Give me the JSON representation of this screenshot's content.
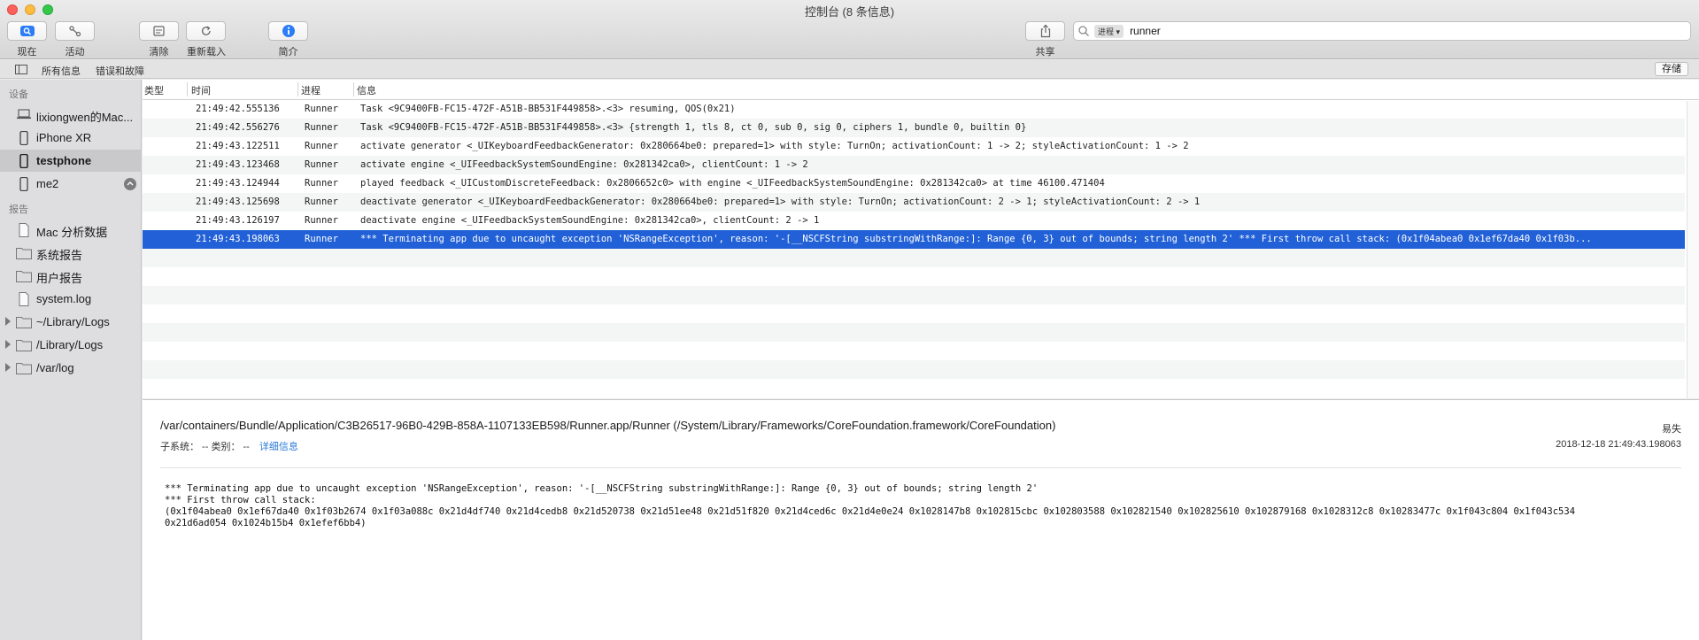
{
  "window": {
    "title": "控制台 (8 条信息)"
  },
  "toolbar": {
    "now_label": "现在",
    "activity_label": "活动",
    "clear_label": "清除",
    "reload_label": "重新载入",
    "info_label": "简介",
    "share_label": "共享",
    "search_filter_chip": "进程",
    "search_query": "runner"
  },
  "filterbar": {
    "all_messages": "所有信息",
    "errors_faults": "错误和故障",
    "save_label": "存储"
  },
  "sidebar": {
    "devices_header": "设备",
    "devices": [
      {
        "label": "lixiongwen的Mac...",
        "icon": "laptop-icon"
      },
      {
        "label": "iPhone XR",
        "icon": "phone-icon"
      },
      {
        "label": "testphone",
        "icon": "phone-icon"
      },
      {
        "label": "me2",
        "icon": "phone-icon"
      }
    ],
    "reports_header": "报告",
    "reports": [
      {
        "label": "Mac 分析数据",
        "icon": "document-icon"
      },
      {
        "label": "系统报告",
        "icon": "folder-icon"
      },
      {
        "label": "用户报告",
        "icon": "folder-icon"
      },
      {
        "label": "system.log",
        "icon": "document-icon"
      },
      {
        "label": "~/Library/Logs",
        "icon": "folder-icon"
      },
      {
        "label": "/Library/Logs",
        "icon": "folder-icon"
      },
      {
        "label": "/var/log",
        "icon": "folder-icon"
      }
    ]
  },
  "table": {
    "columns": [
      "类型",
      "时间",
      "进程",
      "信息"
    ],
    "rows": [
      {
        "time": "21:49:42.555136",
        "process": "Runner",
        "message": "Task <9C9400FB-FC15-472F-A51B-BB531F449858>.<3> resuming, QOS(0x21)"
      },
      {
        "time": "21:49:42.556276",
        "process": "Runner",
        "message": "Task <9C9400FB-FC15-472F-A51B-BB531F449858>.<3> {strength 1, tls 8, ct 0, sub 0, sig 0, ciphers 1, bundle 0, builtin 0}"
      },
      {
        "time": "21:49:43.122511",
        "process": "Runner",
        "message": "activate generator <_UIKeyboardFeedbackGenerator: 0x280664be0: prepared=1> with style: TurnOn; activationCount: 1 -> 2; styleActivationCount: 1 -> 2"
      },
      {
        "time": "21:49:43.123468",
        "process": "Runner",
        "message": "activate engine <_UIFeedbackSystemSoundEngine: 0x281342ca0>, clientCount: 1 -> 2"
      },
      {
        "time": "21:49:43.124944",
        "process": "Runner",
        "message": "played feedback <_UICustomDiscreteFeedback: 0x2806652c0> with engine <_UIFeedbackSystemSoundEngine: 0x281342ca0> at time 46100.471404"
      },
      {
        "time": "21:49:43.125698",
        "process": "Runner",
        "message": "deactivate generator <_UIKeyboardFeedbackGenerator: 0x280664be0: prepared=1> with style: TurnOn; activationCount: 2 -> 1; styleActivationCount: 2 -> 1"
      },
      {
        "time": "21:49:43.126197",
        "process": "Runner",
        "message": "deactivate engine <_UIFeedbackSystemSoundEngine: 0x281342ca0>, clientCount: 2 -> 1"
      },
      {
        "time": "21:49:43.198063",
        "process": "Runner",
        "message": "*** Terminating app due to uncaught exception 'NSRangeException', reason: '-[__NSCFString substringWithRange:]: Range {0, 3} out of bounds; string length 2' *** First throw call stack: (0x1f04abea0 0x1ef67da40 0x1f03b..."
      }
    ]
  },
  "detail": {
    "path": "/var/containers/Bundle/Application/C3B26517-96B0-429B-858A-1107133EB598/Runner.app/Runner (/System/Library/Frameworks/CoreFoundation.framework/CoreFoundation)",
    "subsystem": "子系统： --   类别： --",
    "details_link": "详细信息",
    "volatility": "易失",
    "timestamp": "2018-12-18 21:49:43.198063",
    "body": "*** Terminating app due to uncaught exception 'NSRangeException', reason: '-[__NSCFString substringWithRange:]: Range {0, 3} out of bounds; string length 2'\n*** First throw call stack:\n(0x1f04abea0 0x1ef67da40 0x1f03b2674 0x1f03a088c 0x21d4df740 0x21d4cedb8 0x21d520738 0x21d51ee48 0x21d51f820 0x21d4ced6c 0x21d4e0e24 0x1028147b8 0x102815cbc 0x102803588 0x102821540 0x102825610 0x102879168 0x1028312c8 0x10283477c 0x1f043c804 0x1f043c534\n0x21d6ad054 0x1024b15b4 0x1efef6bb4)"
  },
  "colors": {
    "selection": "#2160d6",
    "accent": "#2a79d6"
  }
}
